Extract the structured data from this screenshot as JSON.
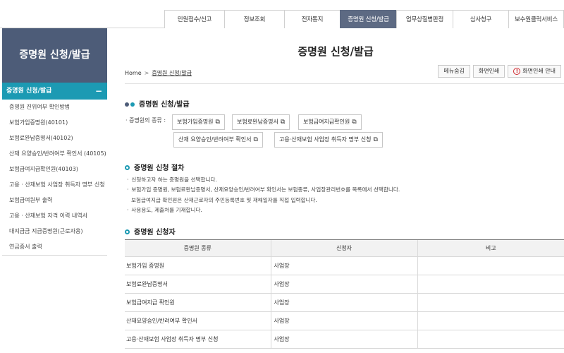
{
  "topnav": {
    "items": [
      {
        "label": "민원접수/신고",
        "active": false
      },
      {
        "label": "정보조회",
        "active": false
      },
      {
        "label": "전자통지",
        "active": false
      },
      {
        "label": "증명원 신청/발급",
        "active": true
      },
      {
        "label": "업무상질병판정",
        "active": false
      },
      {
        "label": "심사청구",
        "active": false
      },
      {
        "label": "보수원클릭서비스",
        "active": false
      }
    ]
  },
  "sidebar": {
    "title": "증명원 신청/발급",
    "active_item": "증명원 신청/발급",
    "active_toggle": "−",
    "items": [
      "증명원 진위여부 확인방법",
      "보험가입증명원(40101)",
      "보험료완납증명서(40102)",
      "산재 요양승인/반려여부 확인서 (40105)",
      "보험급여지급확인원(40103)",
      "고용 · 산재보험 사업장 취득자 명부 신청",
      "보험급여원부 출력",
      "고용 · 산재보험 자격 이력 내역서",
      "대지급금 지급증명원(근로자용)",
      "연금증서 출력"
    ]
  },
  "main": {
    "page_title": "증명원 신청/발급",
    "breadcrumb": {
      "home": "Home",
      "separator": ">",
      "current": "증명원 신청/발급"
    },
    "tools": {
      "menu_hide": "메뉴숨김",
      "print": "화면인쇄",
      "print_guide": "화면인쇄 안내",
      "print_guide_icon": "!"
    },
    "section1": {
      "title": "증명원 신청/발급",
      "types_label": "· 증명원의 종류 :",
      "cert_buttons": [
        "보험가입증명원",
        "보험료완납증명서",
        "보험급여지급확인원",
        "산재 요양승인/반려여부 확인서",
        "고용·산재보험 사업장 취득자 명부 신청"
      ],
      "external_icon": "⧉"
    },
    "section2": {
      "title": "증명원 신청 절차",
      "steps": [
        "신청하고자 하는 증명원을 선택합니다.",
        "보험가입 증명원, 보험료완납증명서, 산재요양승인/반려여부 확인서는 보험종류, 사업장관리번호를 목록에서 선택합니다.",
        "보험급여지급 확인원은 산재근로자의 주민등록번호 및 재해일자를 직접 입력합니다.",
        "사용용도, 제출처를 기재합니다."
      ]
    },
    "section3": {
      "title": "증명원 신청자",
      "columns": [
        "증명원 종류",
        "신청자",
        "비고"
      ],
      "rows": [
        [
          "보험가입 증명원",
          "사업장",
          ""
        ],
        [
          "보험료완납증명서",
          "사업장",
          ""
        ],
        [
          "보험급여지급 확인원",
          "사업장",
          ""
        ],
        [
          "산재요양승인/반려여부 확인서",
          "사업장",
          ""
        ],
        [
          "고용·산재보험 사업장 취득자 명부 신청",
          "사업장",
          ""
        ]
      ]
    }
  },
  "colors": {
    "nav_active": "#5d6a83",
    "sidebar_head": "#4d5c78",
    "accent": "#1c9ab3",
    "warn": "#d0282e"
  }
}
